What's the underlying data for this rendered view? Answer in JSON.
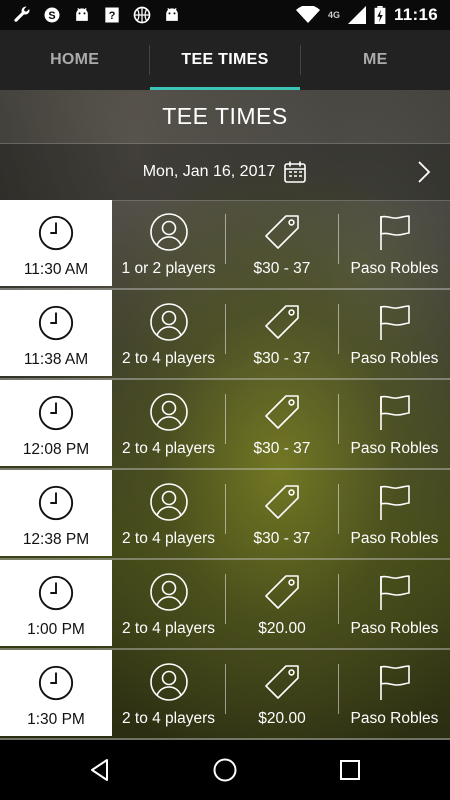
{
  "status_bar": {
    "time": "11:16",
    "network": "4G",
    "left_icons": [
      "wrench-icon",
      "skype-icon",
      "android-icon",
      "unknown-app-icon",
      "basketball-icon",
      "android-icon"
    ],
    "right_icons": [
      "wifi-icon",
      "cell-signal-icon",
      "battery-charging-icon"
    ]
  },
  "tabs": [
    {
      "label": "HOME",
      "active": false
    },
    {
      "label": "TEE TIMES",
      "active": true
    },
    {
      "label": "ME",
      "active": false
    }
  ],
  "page_title": "TEE TIMES",
  "date_bar": {
    "date": "Mon, Jan 16, 2017",
    "icon": "calendar-icon",
    "next_icon": "chevron-right-icon"
  },
  "tee_times": [
    {
      "time": "11:30 AM",
      "players": "1 or 2 players",
      "price": "$30 - 37",
      "course": "Paso Robles"
    },
    {
      "time": "11:38 AM",
      "players": "2 to 4 players",
      "price": "$30 - 37",
      "course": "Paso Robles"
    },
    {
      "time": "12:08 PM",
      "players": "2 to 4 players",
      "price": "$30 - 37",
      "course": "Paso Robles"
    },
    {
      "time": "12:38 PM",
      "players": "2 to 4 players",
      "price": "$30 - 37",
      "course": "Paso Robles"
    },
    {
      "time": "1:00 PM",
      "players": "2 to 4 players",
      "price": "$20.00",
      "course": "Paso Robles"
    },
    {
      "time": "1:30 PM",
      "players": "2 to 4 players",
      "price": "$20.00",
      "course": "Paso Robles"
    }
  ],
  "colors": {
    "accent": "#3cc4b6",
    "tab_bar": "#222222",
    "time_cell": "#ffffff"
  },
  "nav_bar": {
    "icons": [
      "back-icon",
      "home-icon",
      "recents-icon"
    ]
  }
}
